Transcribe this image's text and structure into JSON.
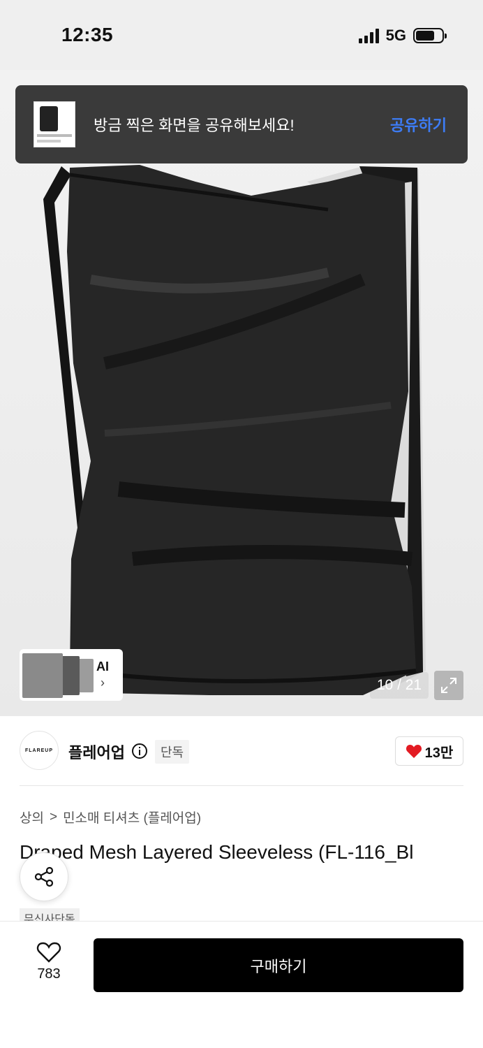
{
  "status_bar": {
    "time": "12:35",
    "network": "5G"
  },
  "toast": {
    "message": "방금 찍은 화면을 공유해보세요!",
    "action_label": "공유하기"
  },
  "gallery": {
    "ai_label": "AI",
    "counter": "10 / 21"
  },
  "brand": {
    "logo_text": "FLAREUP",
    "name": "플레어업",
    "exclusive_badge": "단독",
    "like_count": "13만",
    "heart_color": "#e31b23"
  },
  "breadcrumb": {
    "category": "상의",
    "separator": ">",
    "subcategory": "민소매 티셔츠 (플레어업)"
  },
  "product": {
    "title": "Draped Mesh Layered Sleeveless (FL-116_Bl",
    "store_tag": "무신사단독"
  },
  "bottom_bar": {
    "wish_count": "783",
    "buy_label": "구매하기"
  },
  "colors": {
    "toast_bg": "#3a3a3a",
    "toast_action": "#3d7cf5",
    "buy_button_bg": "#000000"
  }
}
